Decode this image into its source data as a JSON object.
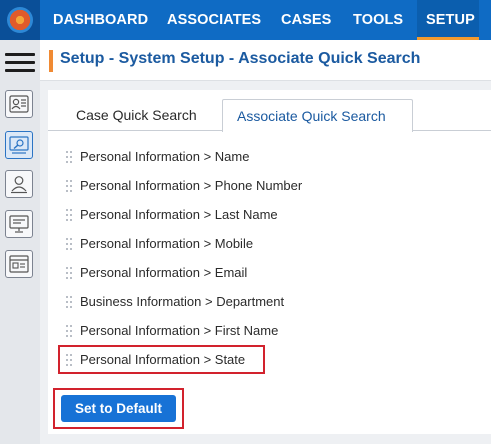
{
  "nav": {
    "items": [
      {
        "label": "DASHBOARD"
      },
      {
        "label": "ASSOCIATES"
      },
      {
        "label": "CASES"
      },
      {
        "label": "TOOLS"
      },
      {
        "label": "SETUP"
      }
    ],
    "active": "SETUP",
    "accent_color": "#f39a2e",
    "bar_color": "#0f6bc4"
  },
  "sidebar": {
    "icons": [
      "menu-icon",
      "associate-card-icon",
      "quick-search-icon",
      "user-icon",
      "monitor-icon",
      "window-icon"
    ]
  },
  "page": {
    "title": "Setup - System Setup - Associate Quick Search"
  },
  "tabs": [
    {
      "label": "Case Quick Search"
    },
    {
      "label": "Associate Quick Search"
    }
  ],
  "active_tab": "Associate Quick Search",
  "fields": [
    "Personal Information > Name",
    "Personal Information > Phone Number",
    "Personal Information > Last Name",
    "Personal Information > Mobile",
    "Personal Information > Email",
    "Business Information > Department",
    "Personal Information > First Name",
    "Personal Information > State"
  ],
  "buttons": {
    "set_default": "Set to Default"
  },
  "highlight_color": "#d2222d"
}
